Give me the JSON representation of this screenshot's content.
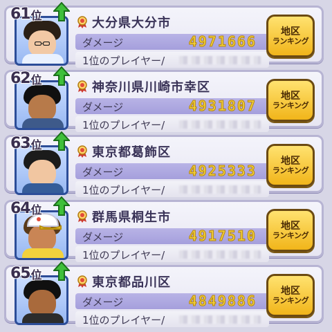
{
  "common": {
    "damage_label": "ダメージ",
    "top_player_label": "1位のプレイヤー/",
    "button_line1": "地区",
    "button_line2": "ランキング"
  },
  "entries": [
    {
      "rank": "61",
      "suffix": "位",
      "region": "大分県大分市",
      "damage": "4971666",
      "avatar": {
        "hair": "#2b2016",
        "skin": "#f2c9a5",
        "shirt": "#e9f1ff",
        "glasses": true,
        "cap": false
      }
    },
    {
      "rank": "62",
      "suffix": "位",
      "region": "神奈川県川崎市幸区",
      "damage": "4931807",
      "avatar": {
        "hair": "#101010",
        "skin": "#b77a4a",
        "shirt": "#3e5a8a",
        "glasses": false,
        "cap": false
      }
    },
    {
      "rank": "63",
      "suffix": "位",
      "region": "東京都葛飾区",
      "damage": "4925333",
      "avatar": {
        "hair": "#1b1b1b",
        "skin": "#f1c6a1",
        "shirt": "#355c99",
        "glasses": false,
        "cap": false
      }
    },
    {
      "rank": "64",
      "suffix": "位",
      "region": "群馬県桐生市",
      "damage": "4917510",
      "avatar": {
        "hair": "#5a3a1a",
        "skin": "#c98555",
        "shirt": "#f2d13d",
        "glasses": false,
        "cap": true
      }
    },
    {
      "rank": "65",
      "suffix": "位",
      "region": "東京都品川区",
      "damage": "4849886",
      "avatar": {
        "hair": "#101010",
        "skin": "#a96a3c",
        "shirt": "#2c2c2c",
        "glasses": false,
        "cap": false
      }
    }
  ],
  "colors": {
    "card_border": "#b7b4d3",
    "avatar_border": "#2c4d98",
    "damage_text": "#f1d03a",
    "button_gold": "#f1b51a",
    "rank_arrow": "#3fbf3a",
    "medal_red": "#e24b3a"
  },
  "icons": {
    "rank_up": "up-arrow-icon",
    "medal": "medal-icon"
  }
}
